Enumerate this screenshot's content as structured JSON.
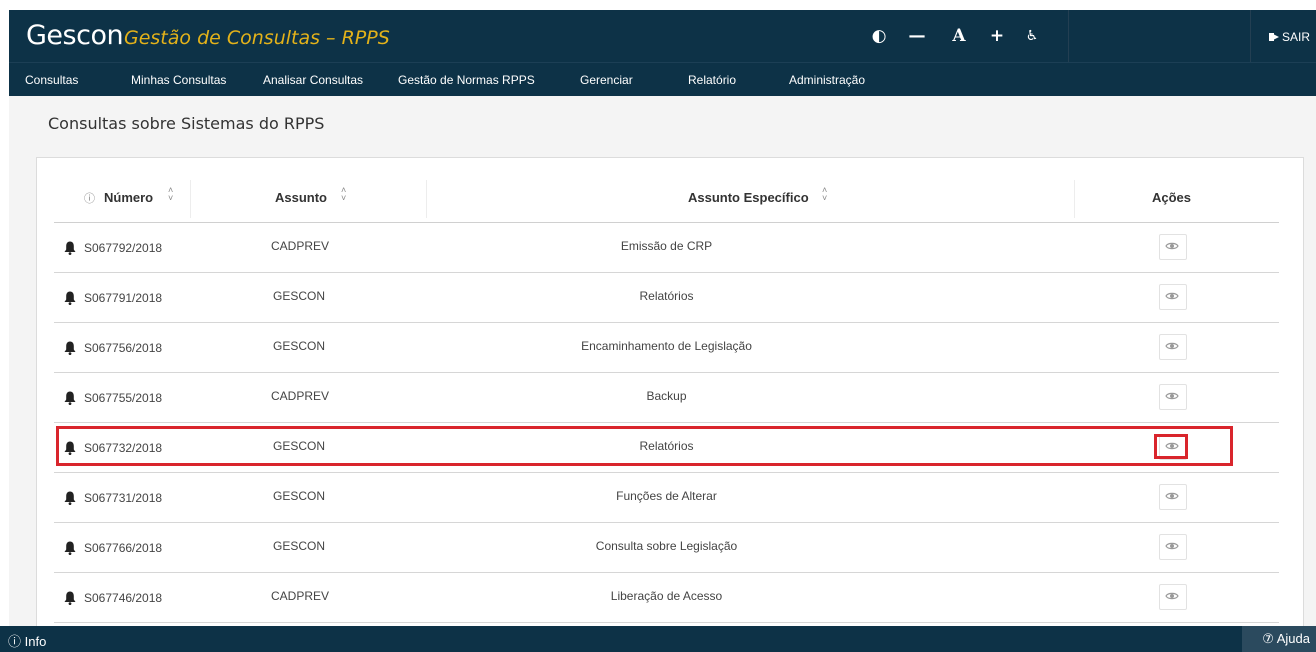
{
  "header": {
    "brand": "Gescon",
    "subtitle": "Gestão de Consultas – RPPS",
    "accessibility": [
      {
        "icon": "contrast-icon",
        "glyph": "◐"
      },
      {
        "icon": "decrease-font-icon",
        "glyph": "—"
      },
      {
        "icon": "font-size-icon",
        "glyph": "A"
      },
      {
        "icon": "increase-font-icon",
        "glyph": "+"
      },
      {
        "icon": "accessibility-icon",
        "glyph": "♿"
      }
    ],
    "logout_label": "SAIR"
  },
  "menu": {
    "items": [
      {
        "label": "Consultas"
      },
      {
        "label": "Minhas Consultas"
      },
      {
        "label": "Analisar Consultas"
      },
      {
        "label": "Gestão de Normas RPPS"
      },
      {
        "label": "Gerenciar"
      },
      {
        "label": "Relatório"
      },
      {
        "label": "Administração"
      }
    ]
  },
  "page": {
    "title": "Consultas sobre Sistemas do RPPS"
  },
  "table": {
    "columns": {
      "numero": "Número",
      "assunto": "Assunto",
      "assunto_especifico": "Assunto Específico",
      "acoes": "Ações"
    },
    "rows": [
      {
        "numero": "S067792/2018",
        "assunto": "CADPREV",
        "especifico": "Emissão de CRP"
      },
      {
        "numero": "S067791/2018",
        "assunto": "GESCON",
        "especifico": "Relatórios"
      },
      {
        "numero": "S067756/2018",
        "assunto": "GESCON",
        "especifico": "Encaminhamento de Legislação"
      },
      {
        "numero": "S067755/2018",
        "assunto": "CADPREV",
        "especifico": "Backup"
      },
      {
        "numero": "S067732/2018",
        "assunto": "GESCON",
        "especifico": "Relatórios"
      },
      {
        "numero": "S067731/2018",
        "assunto": "GESCON",
        "especifico": "Funções de Alterar"
      },
      {
        "numero": "S067766/2018",
        "assunto": "GESCON",
        "especifico": "Consulta sobre Legislação"
      },
      {
        "numero": "S067746/2018",
        "assunto": "CADPREV",
        "especifico": "Liberação de Acesso"
      }
    ],
    "highlighted_row": 4
  },
  "footer": {
    "info_label": "ⓘ Info",
    "help_label": "⑦ Ajuda"
  },
  "colors": {
    "navy": "#0d3247",
    "gold": "#e3b21a",
    "highlight": "#d9252c"
  }
}
